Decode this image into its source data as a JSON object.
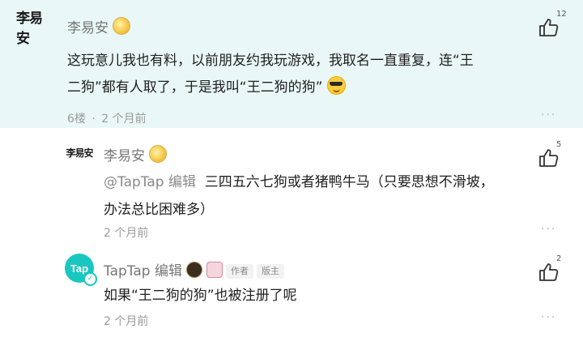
{
  "main_comment": {
    "avatar_text": "李易安",
    "author": "李易安",
    "like_count": "12",
    "text_line1": "这玩意儿我也有料，以前朋友约我玩游戏，我取名一直重复，连“王",
    "text_line2": "二狗”都有人取了，于是我叫“王二狗的狗”",
    "floor": "6楼",
    "separator": "·",
    "time": "2 个月前",
    "more": "···"
  },
  "replies": [
    {
      "avatar_text": "李易安",
      "author": "李易安",
      "like_count": "5",
      "mention": "@TapTap 编辑",
      "text_line1": "三四五六七狗或者猪鸭牛马（只要思想不滑坡，",
      "text_line2": "办法总比困难多）",
      "time": "2 个月前",
      "more": "···"
    },
    {
      "avatar_text": "Tap",
      "author": "TapTap 编辑",
      "tag_author": "作者",
      "tag_mod": "版主",
      "like_count": "2",
      "text_line1": "如果“王二狗的狗”也被注册了呢",
      "time": "2 个月前",
      "more": "···"
    }
  ],
  "colors": {
    "highlight_bg": "#e9f8f6",
    "brand": "#19c7c0"
  }
}
